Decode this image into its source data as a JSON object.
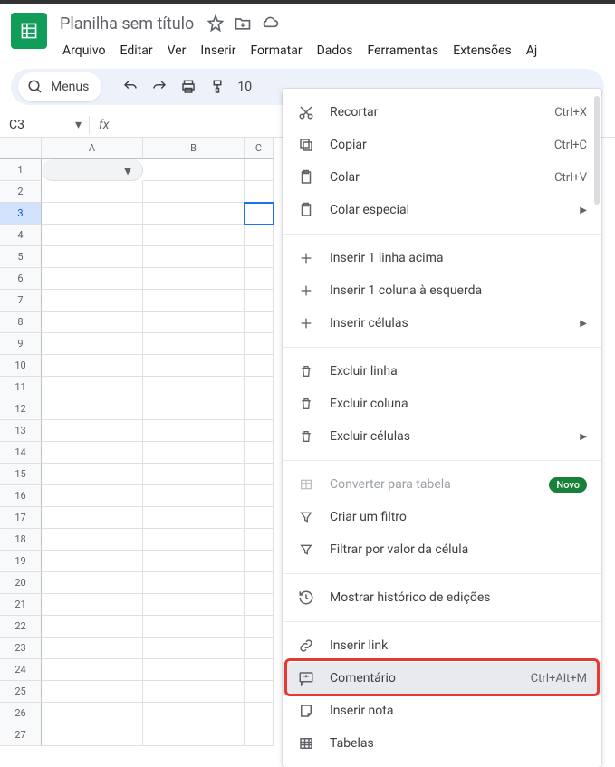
{
  "doc": {
    "title": "Planilha sem título"
  },
  "menubar": [
    "Arquivo",
    "Editar",
    "Ver",
    "Inserir",
    "Formatar",
    "Dados",
    "Ferramentas",
    "Extensões",
    "Aj"
  ],
  "toolbar": {
    "search_label": "Menus",
    "zoom": "10"
  },
  "namebox": {
    "value": "C3"
  },
  "columns": [
    "A",
    "B",
    "C"
  ],
  "rows": [
    1,
    2,
    3,
    4,
    5,
    6,
    7,
    8,
    9,
    10,
    11,
    12,
    13,
    14,
    15,
    16,
    17,
    18,
    19,
    20,
    21,
    22,
    23,
    24,
    25,
    26,
    27
  ],
  "selected_row": 3,
  "context_menu": {
    "cut": {
      "label": "Recortar",
      "shortcut": "Ctrl+X"
    },
    "copy": {
      "label": "Copiar",
      "shortcut": "Ctrl+C"
    },
    "paste": {
      "label": "Colar",
      "shortcut": "Ctrl+V"
    },
    "paste_special": {
      "label": "Colar especial"
    },
    "insert_row_above": {
      "label": "Inserir 1 linha acima"
    },
    "insert_col_left": {
      "label": "Inserir 1 coluna à esquerda"
    },
    "insert_cells": {
      "label": "Inserir células"
    },
    "delete_row": {
      "label": "Excluir linha"
    },
    "delete_col": {
      "label": "Excluir coluna"
    },
    "delete_cells": {
      "label": "Excluir células"
    },
    "convert_table": {
      "label": "Converter para tabela",
      "badge": "Novo"
    },
    "create_filter": {
      "label": "Criar um filtro"
    },
    "filter_by_value": {
      "label": "Filtrar por valor da célula"
    },
    "history": {
      "label": "Mostrar histórico de edições"
    },
    "insert_link": {
      "label": "Inserir link"
    },
    "comment": {
      "label": "Comentário",
      "shortcut": "Ctrl+Alt+M"
    },
    "insert_note": {
      "label": "Inserir nota"
    },
    "tables": {
      "label": "Tabelas"
    }
  }
}
